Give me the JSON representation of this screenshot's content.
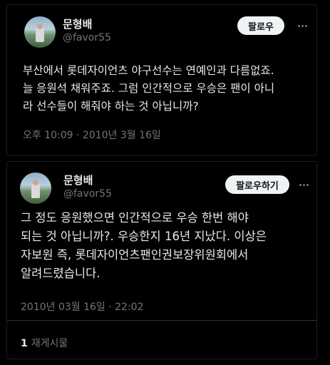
{
  "tweet1": {
    "display_name": "문형배",
    "handle": "@favor55",
    "follow_label": "팔로우",
    "text": "부산에서 롯데자이언츠 야구선수는 연예인과 다름없죠.\n늘 응원석 채워주죠. 그럼 인간적으로 우승은 팬이 아니\n라 선수들이 해줘야 하는 것 아닙니까?",
    "timestamp": "오후 10:09 · 2010년 3월 16일"
  },
  "tweet2": {
    "display_name": "문형배",
    "handle": "@favor55",
    "follow_label": "팔로우하기",
    "text": "그 정도 응원했으면 인간적으로 우승 한번 해야\n되는 것 아닙니까?. 우승한지 16년 지났다. 이상은\n자보원 즉, 롯데자이언츠팬인권보장위원회에서\n알려드렸습니다.",
    "timestamp": "2010년 03월 16일 · 22:02",
    "retweet_count": "1",
    "retweet_label": "재게시물"
  }
}
